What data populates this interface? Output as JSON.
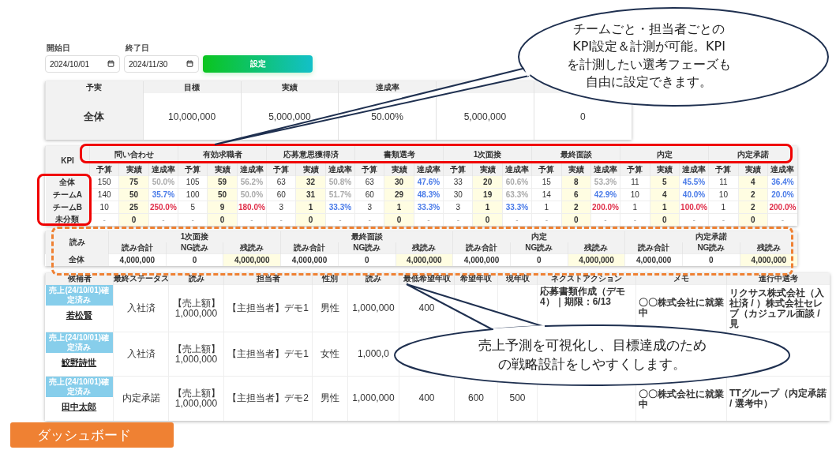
{
  "filters": {
    "start": {
      "label": "開始日",
      "value": "2024/10/01"
    },
    "end": {
      "label": "終了日",
      "value": "2024/11/30"
    },
    "button": "設定"
  },
  "summary": {
    "columns": [
      "予実",
      "目標",
      "実績",
      "達成率"
    ],
    "row": [
      "全体",
      "10,000,000",
      "5,000,000",
      "50.00%",
      "5,000,000",
      "0"
    ]
  },
  "kpi": {
    "header": "KPI",
    "stages": [
      {
        "label": "問い合わせ",
        "subheaders": [
          "予算",
          "実績",
          "達成率"
        ]
      },
      {
        "label": "有効求職者",
        "subheaders": [
          "予算",
          "実績",
          "達成率"
        ]
      },
      {
        "label": "応募意思獲得済",
        "subheaders": [
          "予算",
          "実績",
          "達成率"
        ]
      },
      {
        "label": "書類選考",
        "subheaders": [
          "予算",
          "実績",
          "達成率"
        ]
      },
      {
        "label": "1次面接",
        "subheaders": [
          "予算",
          "実績",
          "達成率"
        ]
      },
      {
        "label": "最終面談",
        "subheaders": [
          "予算",
          "実績",
          "達成率"
        ]
      },
      {
        "label": "内定",
        "subheaders": [
          "予算",
          "実績",
          "達成率"
        ]
      },
      {
        "label": "内定承諾",
        "subheaders": [
          "予算",
          "実績",
          "達成率"
        ]
      }
    ],
    "rows": [
      {
        "label": "全体",
        "cells": [
          {
            "budget": "150",
            "actual": "75",
            "rate": "50.0%",
            "color": "#aaaaaa"
          },
          {
            "budget": "105",
            "actual": "59",
            "rate": "56.2%",
            "color": "#aaaaaa"
          },
          {
            "budget": "63",
            "actual": "32",
            "rate": "50.8%",
            "color": "#aaaaaa"
          },
          {
            "budget": "63",
            "actual": "30",
            "rate": "47.6%",
            "color": "#4a7be8"
          },
          {
            "budget": "33",
            "actual": "20",
            "rate": "60.6%",
            "color": "#aaaaaa"
          },
          {
            "budget": "15",
            "actual": "8",
            "rate": "53.3%",
            "color": "#aaaaaa"
          },
          {
            "budget": "11",
            "actual": "5",
            "rate": "45.5%",
            "color": "#4a7be8"
          },
          {
            "budget": "11",
            "actual": "4",
            "rate": "36.4%",
            "color": "#4a7be8"
          }
        ]
      },
      {
        "label": "チームA",
        "cells": [
          {
            "budget": "140",
            "actual": "50",
            "rate": "35.7%",
            "color": "#4a7be8"
          },
          {
            "budget": "100",
            "actual": "50",
            "rate": "50.0%",
            "color": "#aaaaaa"
          },
          {
            "budget": "60",
            "actual": "31",
            "rate": "51.7%",
            "color": "#aaaaaa"
          },
          {
            "budget": "60",
            "actual": "29",
            "rate": "48.3%",
            "color": "#4a7be8"
          },
          {
            "budget": "30",
            "actual": "19",
            "rate": "63.3%",
            "color": "#aaaaaa"
          },
          {
            "budget": "14",
            "actual": "6",
            "rate": "42.9%",
            "color": "#4a7be8"
          },
          {
            "budget": "10",
            "actual": "4",
            "rate": "40.0%",
            "color": "#4a7be8"
          },
          {
            "budget": "10",
            "actual": "2",
            "rate": "20.0%",
            "color": "#4a7be8"
          }
        ]
      },
      {
        "label": "チームB",
        "cells": [
          {
            "budget": "10",
            "actual": "25",
            "rate": "250.0%",
            "color": "#e0304a"
          },
          {
            "budget": "5",
            "actual": "9",
            "rate": "180.0%",
            "color": "#e0304a"
          },
          {
            "budget": "3",
            "actual": "1",
            "rate": "33.3%",
            "color": "#4a7be8"
          },
          {
            "budget": "3",
            "actual": "1",
            "rate": "33.3%",
            "color": "#4a7be8"
          },
          {
            "budget": "3",
            "actual": "1",
            "rate": "33.3%",
            "color": "#4a7be8"
          },
          {
            "budget": "1",
            "actual": "2",
            "rate": "200.0%",
            "color": "#e0304a"
          },
          {
            "budget": "1",
            "actual": "1",
            "rate": "100.0%",
            "color": "#e0304a"
          },
          {
            "budget": "1",
            "actual": "2",
            "rate": "200.0%",
            "color": "#e0304a"
          }
        ]
      },
      {
        "label": "未分類",
        "cells": [
          {
            "budget": "-",
            "actual": "0",
            "rate": "-"
          },
          {
            "budget": "-",
            "actual": "0",
            "rate": "-"
          },
          {
            "budget": "-",
            "actual": "0",
            "rate": "-"
          },
          {
            "budget": "-",
            "actual": "0",
            "rate": "-"
          },
          {
            "budget": "-",
            "actual": "0",
            "rate": "-"
          },
          {
            "budget": "-",
            "actual": "0",
            "rate": "-"
          },
          {
            "budget": "-",
            "actual": "0",
            "rate": "-"
          },
          {
            "budget": "-",
            "actual": "0",
            "rate": "-"
          }
        ]
      }
    ]
  },
  "yomi": {
    "header": "読み",
    "stages": [
      {
        "label": "1次面接",
        "subheaders": [
          "読み合計",
          "NG読み",
          "残読み"
        ]
      },
      {
        "label": "最終面談",
        "subheaders": [
          "読み合計",
          "NG読み",
          "残読み"
        ]
      },
      {
        "label": "内定",
        "subheaders": [
          "読み合計",
          "NG読み",
          "残読み"
        ]
      },
      {
        "label": "内定承諾",
        "subheaders": [
          "読み合計",
          "NG読み",
          "残読み"
        ]
      }
    ],
    "rows": [
      {
        "label": "全体",
        "cells": [
          "4,000,000",
          "0",
          "4,000,000",
          "4,000,000",
          "0",
          "4,000,000",
          "4,000,000",
          "0",
          "4,000,000",
          "4,000,000",
          "0",
          "4,000,000"
        ]
      }
    ]
  },
  "candidates": {
    "columns": [
      "候補者",
      "最終ステータス",
      "読み",
      "担当者",
      "性別",
      "読み",
      "最低希望年収",
      "希望年収",
      "現年収",
      "ネクストアクション",
      "メモ",
      "進行中選考"
    ],
    "rows": [
      {
        "cells": [
          {
            "badge": "売上(24/10/01)確定済み",
            "name": "若松賢"
          },
          "入社済",
          "【売上額】1,000,000",
          "【主担当者】デモ1",
          "男性",
          "1,000,000",
          "400",
          null,
          null,
          "応募書類作成（デモ4）｜期限：6/13",
          "〇〇株式会社に就業中",
          "リクサス株式会社（入社済 / ）株式会社セレブ（カジュアル面談 / 見"
        ]
      },
      {
        "cells": [
          {
            "badge": "売上(24/10/01)確定済み",
            "name": "鮫野詩世"
          },
          "入社済",
          "【売上額】1,000,000",
          "【主担当者】デモ1",
          "女性",
          "1,000,0",
          null,
          null,
          null,
          null,
          null,
          null
        ]
      },
      {
        "cells": [
          {
            "badge": "売上(24/10/01)確定済み",
            "name": "田中太郎"
          },
          "内定承諾",
          "【売上額】1,000,000",
          "【主担当者】デモ2",
          "男性",
          "1,000,000",
          "400",
          "600",
          "500",
          null,
          "〇〇株式会社に就業中",
          "TTグループ（内定承諾 / 選考中）"
        ]
      }
    ]
  },
  "callouts": [
    {
      "lines": [
        "チームごと・担当者ごとの",
        "KPI設定＆計測が可能。KPI",
        "を計測したい選考フェーズも",
        "自由に設定できます。"
      ]
    },
    {
      "lines": [
        "売上予測を可視化し、目標達成のため",
        "の戦略設計をしやすくします。"
      ]
    }
  ],
  "footer_label": "ダッシュボード"
}
